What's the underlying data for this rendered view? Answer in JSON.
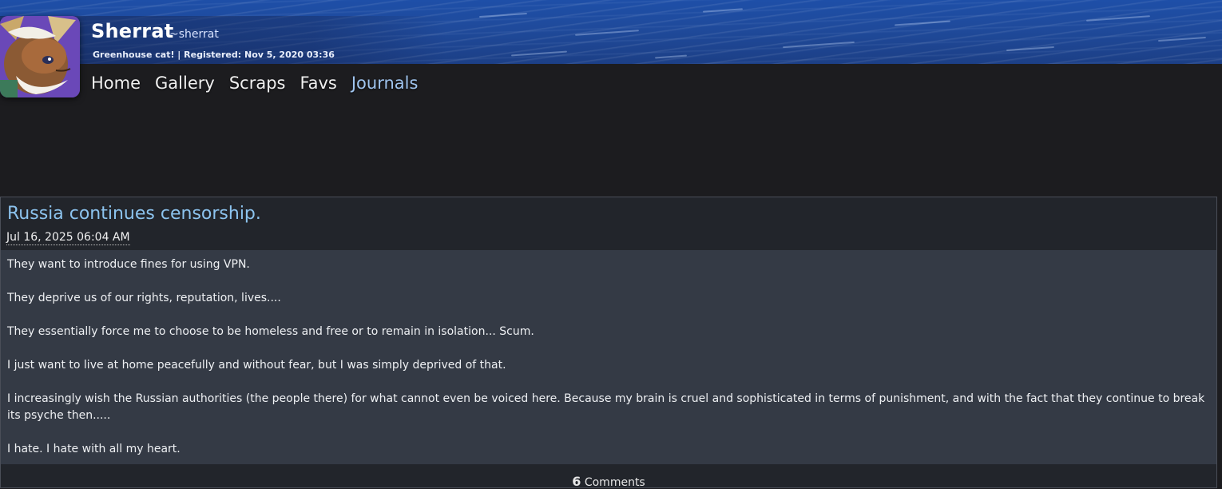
{
  "profile": {
    "display_name": "Sherrat",
    "handle": "~sherrat",
    "tagline": "Greenhouse cat! | Registered: Nov 5, 2020 03:36"
  },
  "nav": {
    "home": "Home",
    "gallery": "Gallery",
    "scraps": "Scraps",
    "favs": "Favs",
    "journals": "Journals"
  },
  "journal": {
    "title": "Russia continues censorship.",
    "date": "Jul 16, 2025 06:04 AM",
    "paragraphs": [
      "They want to introduce fines for using VPN.",
      "They deprive us of our rights, reputation, lives....",
      "They essentially force me to choose to be homeless and free or to remain in isolation... Scum.",
      "I just want to live at home peacefully and without fear, but I was simply deprived of that.",
      "I increasingly wish the Russian authorities (the people there) for what cannot even be voiced here. Because my brain is cruel and sophisticated in terms of punishment, and with the fact that they continue to break its psyche then.....",
      "I hate. I hate with all my heart."
    ],
    "comment_count": "6",
    "comments_label": "Comments"
  },
  "colors": {
    "banner": "#1f4a9b",
    "link_active": "#9fc4ee",
    "title": "#8cc3ee",
    "body_bg": "#343a45",
    "page_bg": "#1c1c1f"
  }
}
